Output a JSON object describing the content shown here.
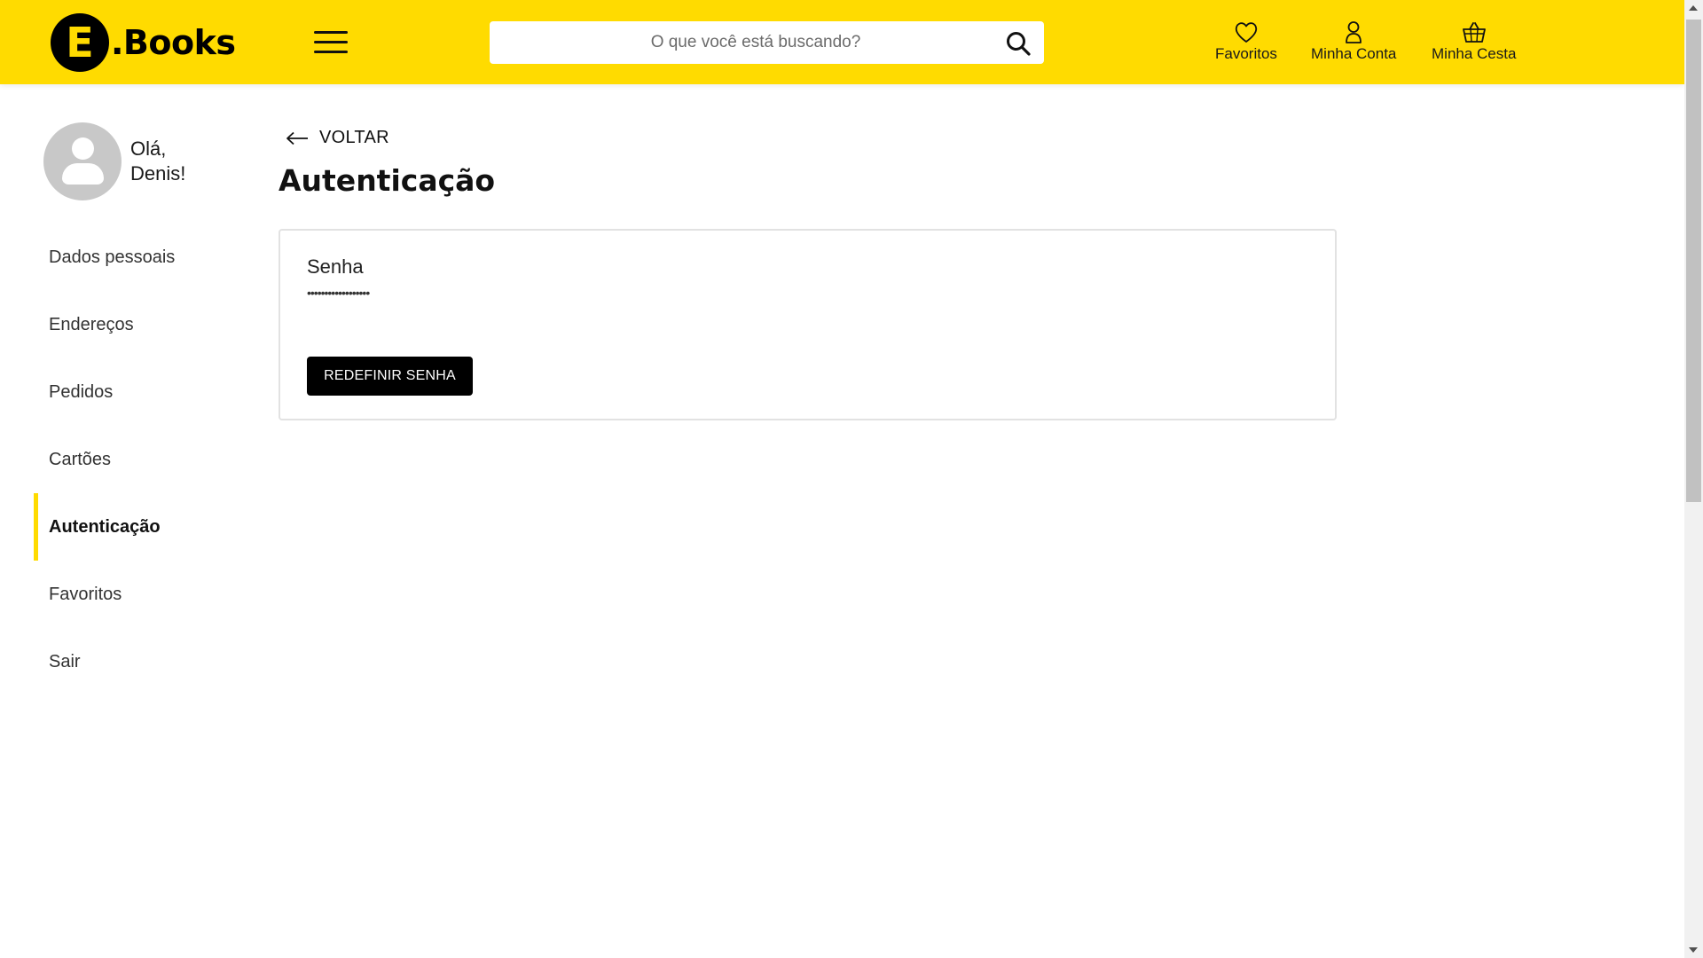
{
  "header": {
    "logo_letter": "E",
    "logo_text": ".Books",
    "search_placeholder": "O que você está buscando?",
    "nav": {
      "favorites": "Favoritos",
      "account": "Minha Conta",
      "basket": "Minha Cesta"
    }
  },
  "sidebar": {
    "greeting_line1": "Olá,",
    "greeting_line2": "Denis!",
    "items": [
      {
        "label": "Dados pessoais",
        "active": false
      },
      {
        "label": "Endereços",
        "active": false
      },
      {
        "label": "Pedidos",
        "active": false
      },
      {
        "label": "Cartões",
        "active": false
      },
      {
        "label": "Autenticação",
        "active": true
      },
      {
        "label": "Favoritos",
        "active": false
      },
      {
        "label": "Sair",
        "active": false
      }
    ]
  },
  "main": {
    "back_label": "VOLTAR",
    "title": "Autenticação",
    "card": {
      "field_label": "Senha",
      "field_value": "••••••••••••••••••",
      "button_label": "REDEFINIR SENHA"
    }
  },
  "colors": {
    "brand_yellow": "#ffdb00",
    "black": "#000000"
  }
}
